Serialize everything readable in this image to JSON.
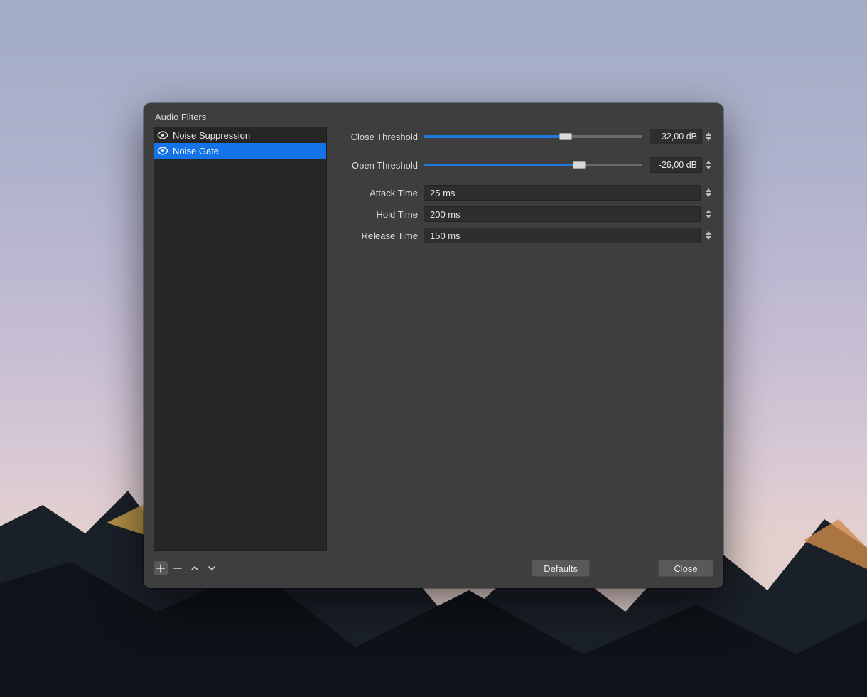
{
  "dialog": {
    "title": "Audio Filters"
  },
  "sidebar": {
    "filters": [
      {
        "label": "Noise Suppression",
        "selected": false
      },
      {
        "label": "Noise Gate",
        "selected": true
      }
    ]
  },
  "params": {
    "close_threshold": {
      "label": "Close Threshold",
      "value": "-32,00 dB",
      "percent": 65
    },
    "open_threshold": {
      "label": "Open Threshold",
      "value": "-26,00 dB",
      "percent": 71
    },
    "attack_time": {
      "label": "Attack Time",
      "value": "25 ms"
    },
    "hold_time": {
      "label": "Hold Time",
      "value": "200 ms"
    },
    "release_time": {
      "label": "Release Time",
      "value": "150 ms"
    }
  },
  "buttons": {
    "defaults": "Defaults",
    "close": "Close"
  },
  "icons": {
    "add": "plus-icon",
    "remove": "minus-icon",
    "move_up": "chevron-up-icon",
    "move_down": "chevron-down-icon",
    "visibility": "eye-icon"
  }
}
